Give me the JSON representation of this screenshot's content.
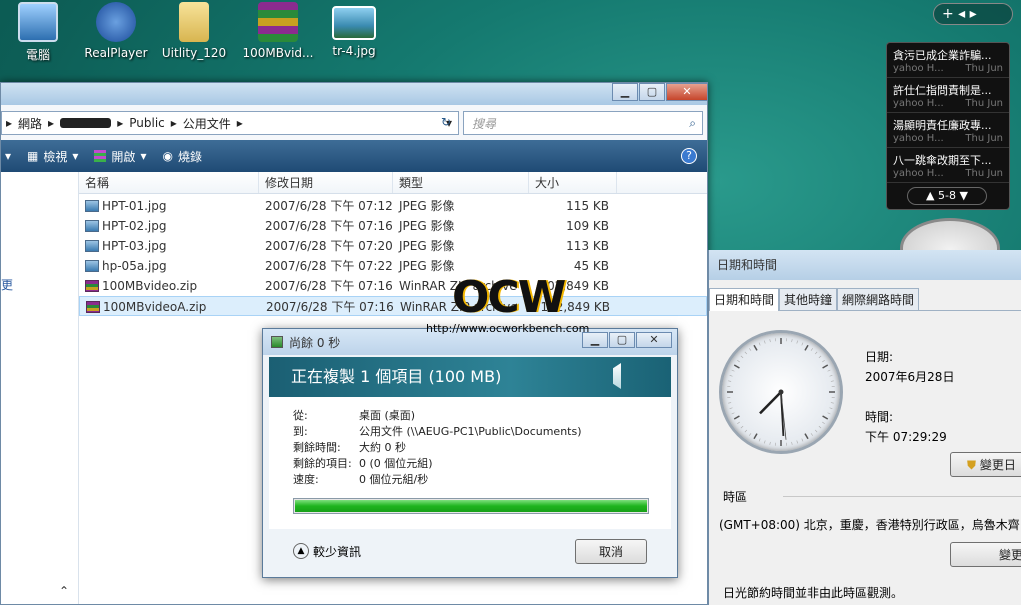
{
  "desktop": {
    "icons": [
      {
        "label": "電腦",
        "icon": "computer-icon"
      },
      {
        "label": "RealPlayer",
        "icon": "realplayer-icon"
      },
      {
        "label": "Uitlity_120",
        "icon": "folder-icon"
      },
      {
        "label": "100MBvid...",
        "icon": "winrar-icon"
      },
      {
        "label": "tr-4.jpg",
        "icon": "image-icon"
      }
    ],
    "sidebar_controls": "+  ◂ ▸"
  },
  "explorer": {
    "breadcrumb": [
      "網路",
      "▸",
      "Public",
      "▸",
      "公用文件",
      "▸"
    ],
    "breadcrumb_redacted": "●●●●●●",
    "search_placeholder": "搜尋",
    "toolbar": {
      "views": "檢視",
      "open": "開啟",
      "burn": "燒錄"
    },
    "left_pane_fragment": "更",
    "columns": [
      "名稱",
      "修改日期",
      "類型",
      "大小"
    ],
    "files": [
      {
        "name": "HPT-01.jpg",
        "date": "2007/6/28 下午 07:12",
        "type": "JPEG 影像",
        "size": "115 KB",
        "kind": "jpg"
      },
      {
        "name": "HPT-02.jpg",
        "date": "2007/6/28 下午 07:16",
        "type": "JPEG 影像",
        "size": "109 KB",
        "kind": "jpg"
      },
      {
        "name": "HPT-03.jpg",
        "date": "2007/6/28 下午 07:20",
        "type": "JPEG 影像",
        "size": "113 KB",
        "kind": "jpg"
      },
      {
        "name": "hp-05a.jpg",
        "date": "2007/6/28 下午 07:22",
        "type": "JPEG 影像",
        "size": "45 KB",
        "kind": "jpg"
      },
      {
        "name": "100MBvideo.zip",
        "date": "2007/6/28 下午 07:16",
        "type": "WinRAR ZIP archive",
        "size": "102,849 KB",
        "kind": "zip"
      },
      {
        "name": "100MBvideoA.zip",
        "date": "2007/6/28 下午 07:16",
        "type": "WinRAR ZIP archive",
        "size": "102,849 KB",
        "kind": "zip",
        "selected": true
      }
    ]
  },
  "copy_dialog": {
    "title": "尚餘 0 秒",
    "heading": "正在複製 1 個項目 (100 MB)",
    "details": [
      {
        "k": "從:",
        "v": "桌面 (桌面)"
      },
      {
        "k": "到:",
        "v": "公用文件 (\\\\AEUG-PC1\\Public\\Documents)"
      },
      {
        "k": "剩餘時間:",
        "v": "大約 0 秒"
      },
      {
        "k": "剩餘的項目:",
        "v": "0 (0 個位元組)"
      },
      {
        "k": "速度:",
        "v": "0 個位元組/秒"
      }
    ],
    "progress_fraction": 1.0,
    "less_info": "較少資訊",
    "cancel": "取消"
  },
  "datetime_dialog": {
    "title": "日期和時間",
    "tabs": [
      "日期和時間",
      "其他時鐘",
      "網際網路時間"
    ],
    "date_label": "日期:",
    "date_value": "2007年6月28日",
    "time_label": "時間:",
    "time_value": "下午 07:29:29",
    "change_datetime_button": "變更日",
    "timezone_label": "時區",
    "timezone_value": "(GMT+08:00) 北京，重慶，香港特別行政區，烏魯木齊",
    "change_tz_button": "變更",
    "dst_note": "日光節約時間並非由此時區觀測。",
    "clock": {
      "hour": 7,
      "minute": 29,
      "second": 29
    }
  },
  "news_gadget": {
    "items": [
      {
        "title": "貪污已成企業詐騙...",
        "source": "yahoo H...",
        "date": "Thu Jun"
      },
      {
        "title": "許仕仁指問責制是...",
        "source": "yahoo H...",
        "date": "Thu Jun"
      },
      {
        "title": "湯顯明責任廉政專...",
        "source": "yahoo H...",
        "date": "Thu Jun"
      },
      {
        "title": "八一跳傘改期至下...",
        "source": "yahoo H...",
        "date": "Thu Jun"
      }
    ],
    "pager": "5-8"
  },
  "watermark": {
    "logo": "OCW",
    "url": "http://www.ocworkbench.com"
  }
}
